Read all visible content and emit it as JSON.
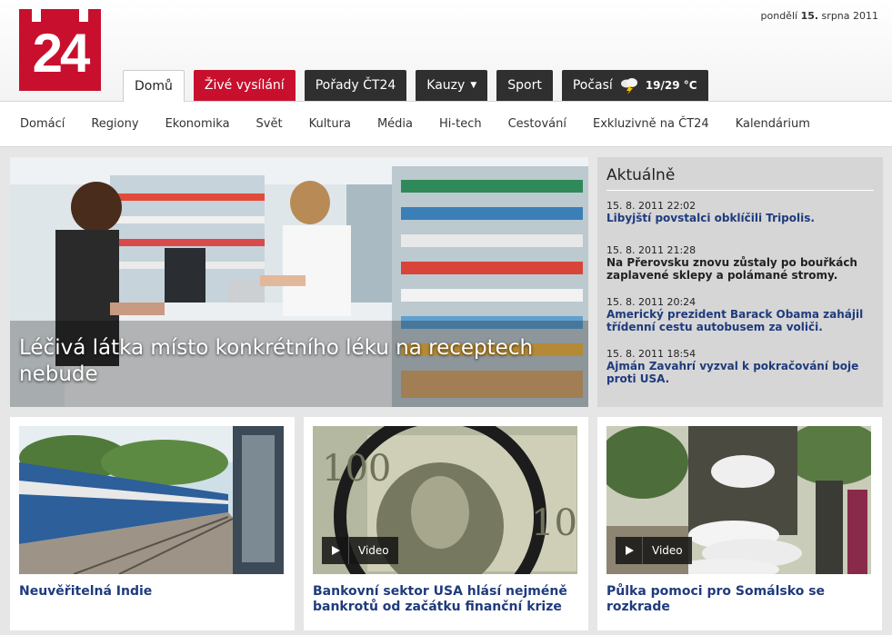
{
  "header": {
    "logo_text": "24",
    "date_prefix": "pondělí ",
    "date_day": "15.",
    "date_suffix": " srpna 2011"
  },
  "tabs": {
    "home": "Domů",
    "live": "Živé vysílání",
    "shows": "Pořady ČT24",
    "cases": "Kauzy",
    "sport": "Sport",
    "weather": "Počasí",
    "weather_temp": "19/29 °C"
  },
  "subnav": [
    "Domácí",
    "Regiony",
    "Ekonomika",
    "Svět",
    "Kultura",
    "Média",
    "Hi-tech",
    "Cestování",
    "Exkluzivně na ČT24",
    "Kalendárium"
  ],
  "hero": {
    "caption": "Léčivá látka místo konkrétního léku na receptech nebude"
  },
  "news": {
    "title": "Aktuálně",
    "items": [
      {
        "time": "15. 8. 2011 22:02",
        "headline": "Libyjští povstalci obklíčili Tripolis."
      },
      {
        "time": "15. 8. 2011 21:28",
        "headline": "Na Přerovsku znovu zůstaly po bouřkách zaplavené sklepy a polámané stromy."
      },
      {
        "time": "15. 8. 2011 20:24",
        "headline": "Americký prezident Barack Obama zahájil třídenní cestu autobusem za voliči."
      },
      {
        "time": "15. 8. 2011 18:54",
        "headline": "Ajmán Zavahrí vyzval k pokračování boje proti USA."
      }
    ]
  },
  "cards": [
    {
      "caption": "Neuvěřitelná Indie"
    },
    {
      "caption": "Bankovní sektor USA hlásí nejméně bankrotů od začátku finanční krize",
      "badge": "Video"
    },
    {
      "caption": "Půlka pomoci pro Somálsko se rozkrade",
      "badge": "Video"
    }
  ],
  "colors": {
    "brand_red": "#c8102e",
    "tab_dark": "#2f2f2f",
    "link_blue": "#1f3b7d"
  }
}
